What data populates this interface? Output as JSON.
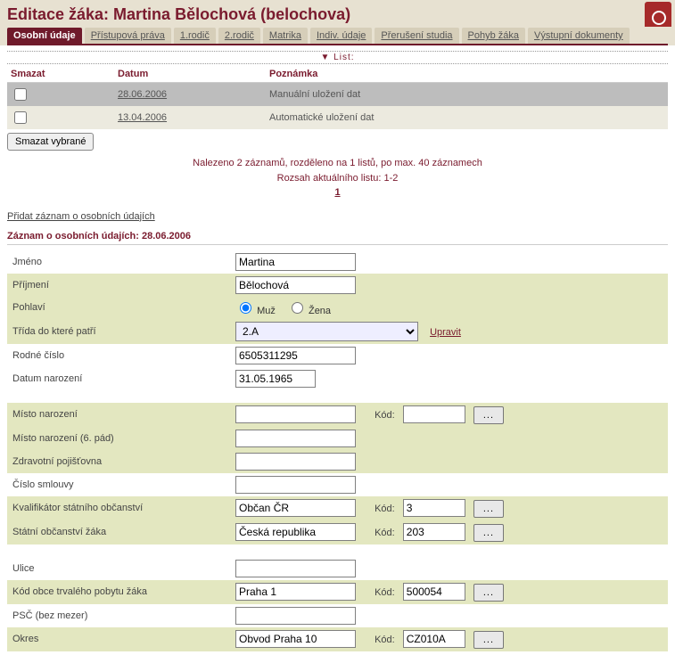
{
  "header": {
    "title": "Editace žáka: Martina Bělochová (belochova)"
  },
  "tabs": [
    {
      "label": "Osobní údaje",
      "active": true
    },
    {
      "label": "Přístupová práva"
    },
    {
      "label": "1.rodič"
    },
    {
      "label": "2.rodič"
    },
    {
      "label": "Matrika"
    },
    {
      "label": "Indiv. údaje"
    },
    {
      "label": "Přerušení studia"
    },
    {
      "label": "Pohyb žáka"
    },
    {
      "label": "Výstupní dokumenty"
    }
  ],
  "list": {
    "band_label": "▼ List:",
    "headers": {
      "del": "Smazat",
      "date": "Datum",
      "note": "Poznámka"
    },
    "rows": [
      {
        "date": "28.06.2006",
        "note": "Manuální uložení dat"
      },
      {
        "date": "13.04.2006",
        "note": "Automatické uložení dat"
      }
    ],
    "delete_button": "Smazat vybrané",
    "pager_line1": "Nalezeno 2 záznamů, rozděleno na 1 listů, po max. 40 záznamech",
    "pager_line2": "Rozsah aktuálního listu: 1-2",
    "pager_current": "1",
    "add_link": "Přidat záznam o osobních údajích"
  },
  "section": {
    "title": "Záznam o osobních údajích: 28.06.2006"
  },
  "form": {
    "firstname_label": "Jméno",
    "firstname": "Martina",
    "lastname_label": "Příjmení",
    "lastname": "Bělochová",
    "gender_label": "Pohlaví",
    "gender_male": "Muž",
    "gender_female": "Žena",
    "class_label": "Třída do které patří",
    "class_value": "2.A",
    "class_edit": "Upravit",
    "rc_label": "Rodné číslo",
    "rc": "6505311295",
    "birthdate_label": "Datum narození",
    "birthdate": "31.05.1965",
    "birthplace_label": "Místo narození",
    "birthplace": "",
    "birthplace_code": "",
    "birthplace6_label": "Místo narození (6. pád)",
    "birthplace6": "",
    "insurance_label": "Zdravotní pojišťovna",
    "insurance": "",
    "contract_label": "Číslo smlouvy",
    "contract": "",
    "citizenship_q_label": "Kvalifikátor státního občanství",
    "citizenship_q": "Občan ČR",
    "citizenship_q_code": "3",
    "citizenship_label": "Státní občanství žáka",
    "citizenship": "Česká republika",
    "citizenship_code": "203",
    "street_label": "Ulice",
    "street": "",
    "muni_label": "Kód obce trvalého pobytu žáka",
    "muni": "Praha 1",
    "muni_code": "500054",
    "psc_label": "PSČ (bez mezer)",
    "psc": "",
    "district_label": "Okres",
    "district": "Obvod Praha 10",
    "district_code": "CZ010A",
    "code_label": "Kód:",
    "browse": "..."
  }
}
